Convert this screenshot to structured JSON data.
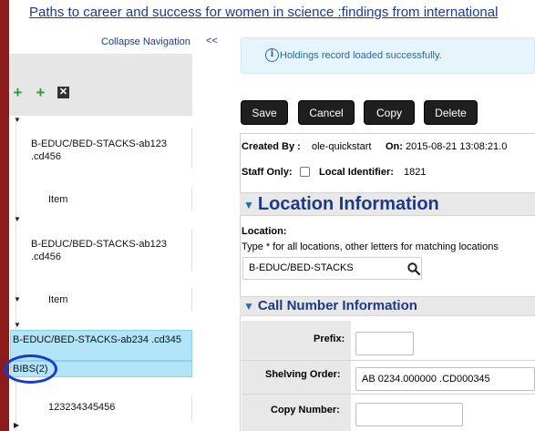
{
  "header": {
    "title_link": "Paths to career and success for women in science :findings from international"
  },
  "nav": {
    "collapse_label": "Collapse Navigation",
    "collapse_arrows": "<<",
    "tree": [
      {
        "label": "B-EDUC/BED-STACKS-ab123 .cd456"
      },
      {
        "label": "Item"
      },
      {
        "label": "B-EDUC/BED-STACKS-ab123 .cd456"
      },
      {
        "label": "Item"
      },
      {
        "label": "B-EDUC/BED-STACKS-ab234 .cd345"
      },
      {
        "label": "BIBS(2)"
      },
      {
        "label": "123234345456"
      }
    ]
  },
  "banner": {
    "icon": "i",
    "message": "Holdings record loaded successfully."
  },
  "actions": {
    "save": "Save",
    "cancel": "Cancel",
    "copy": "Copy",
    "delete": "Delete"
  },
  "record": {
    "created_by_label": "Created By :",
    "created_by_value": "ole-quickstart",
    "on_label": "On:",
    "on_value": "2015-08-21 13:08:21.0",
    "staff_only_label": "Staff Only:",
    "local_id_label": "Local Identifier:",
    "local_id_value": "1821"
  },
  "location": {
    "section_title": "Location Information",
    "field_label": "Location:",
    "hint": "Type * for all locations, other letters for matching locations",
    "value": "B-EDUC/BED-STACKS"
  },
  "call_number": {
    "section_title": "Call Number Information",
    "prefix_label": "Prefix:",
    "prefix_value": "",
    "shelving_label": "Shelving Order:",
    "shelving_value": "AB 0234.000000 .CD000345",
    "copy_label": "Copy Number:",
    "copy_value": ""
  },
  "colors": {
    "title_link": "#1a3a9a",
    "selected_node_bg": "#b3e5f8",
    "section_title": "#1d3a8a",
    "banner_bg": "#e5f4fa",
    "button_bg": "#1f1f1f",
    "highlight_circle": "#1a3acc"
  }
}
